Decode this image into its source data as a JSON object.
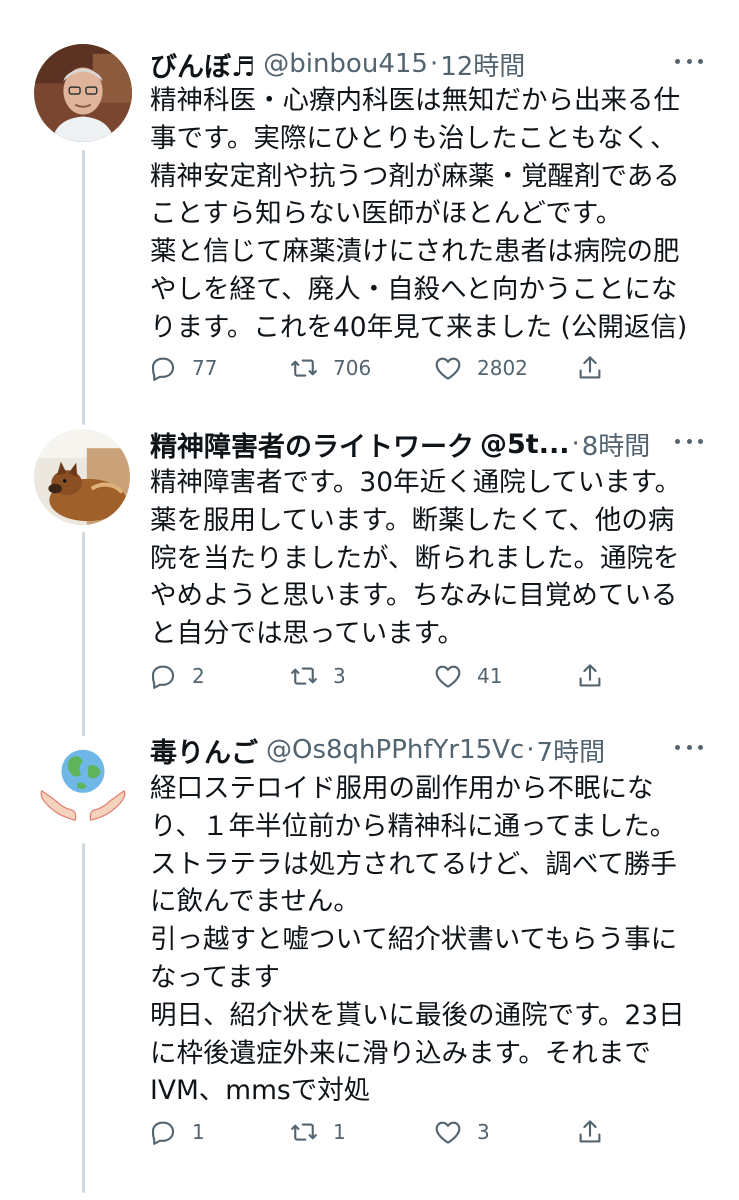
{
  "tweets": [
    {
      "name": "びんぼ♬",
      "handle": "@binbou415",
      "separator": "·",
      "time": "12時間",
      "avatar": "avatar-man-photo",
      "lines": [
        "精神科医・心療内科医は無知だから出来る仕",
        "事です。実際にひとりも治したこともなく、",
        "精神安定剤や抗うつ剤が麻薬・覚醒剤である",
        "ことすら知らない医師がほとんどです。",
        "薬と信じて麻薬漬けにされた患者は病院の肥",
        "やしを経て、廃人・自殺へと向かうことにな",
        "ります。これを40年見て来ました (公開返信)"
      ],
      "replies": "77",
      "retweets": "706",
      "likes": "2802"
    },
    {
      "name": "精神障害者のライトワーク",
      "handle": "@5t...",
      "separator": "·",
      "time": "8時間",
      "avatar": "avatar-dog-photo",
      "lines": [
        "精神障害者です。30年近く通院しています。",
        "薬を服用しています。断薬したくて、他の病",
        "院を当たりましたが、断られました。通院を",
        "やめようと思います。ちなみに目覚めている",
        "と自分では思っています。"
      ],
      "replies": "2",
      "retweets": "3",
      "likes": "41"
    },
    {
      "name": "毒りんご",
      "handle": "@Os8qhPPhfYr15Vc",
      "separator": "·",
      "time": "7時間",
      "avatar": "avatar-earth-hands",
      "lines": [
        "経口ステロイド服用の副作用から不眠にな",
        "り、１年半位前から精神科に通ってました。",
        "ストラテラは処方されてるけど、調べて勝手",
        "に飲んでません。",
        "引っ越すと嘘ついて紹介状書いてもらう事に",
        "なってます",
        "明日、紹介状を貰いに最後の通院です。23日",
        "に枠後遺症外来に滑り込みます。それまで",
        "IVM、mmsで対処"
      ],
      "replies": "1",
      "retweets": "1",
      "likes": "3"
    }
  ],
  "icons": {
    "reply": "reply-icon",
    "retweet": "retweet-icon",
    "like": "like-icon",
    "share": "share-icon",
    "more": "more-icon"
  },
  "colors": {
    "text": "#0f1419",
    "secondary": "#536471",
    "thread_line": "#cfd9de"
  }
}
